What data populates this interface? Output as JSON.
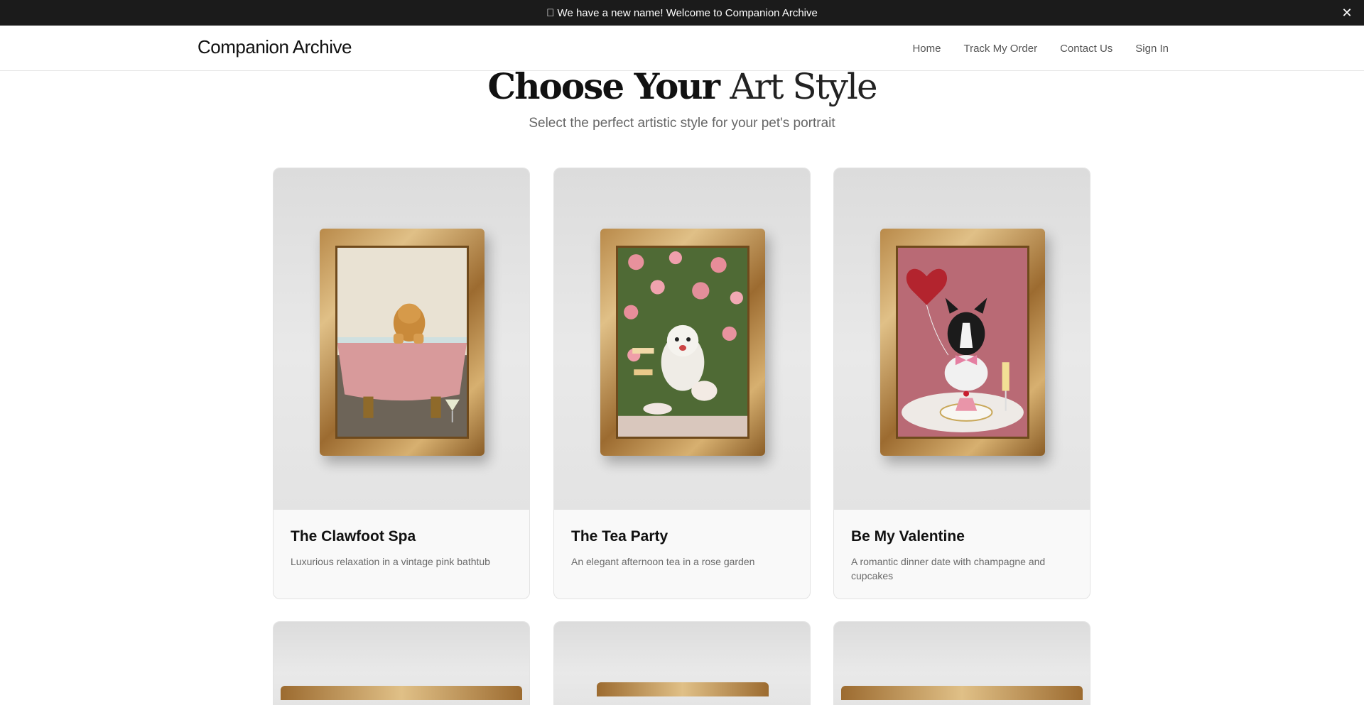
{
  "announcement": {
    "text": " We have a new name! Welcome to Companion Archive",
    "close_icon": "✕"
  },
  "navbar": {
    "brand": "Companion Archive",
    "links": [
      "Home",
      "Track My Order",
      "Contact Us",
      "Sign In"
    ]
  },
  "hero": {
    "title_part1": "Choose Your",
    "title_part2": "Art Style",
    "subtitle": "Select the perfect artistic style for your pet's portrait"
  },
  "styles": [
    {
      "title": "The Clawfoot Spa",
      "description": "Luxurious relaxation in a vintage pink bathtub"
    },
    {
      "title": "The Tea Party",
      "description": "An elegant afternoon tea in a rose garden"
    },
    {
      "title": "Be My Valentine",
      "description": "A romantic dinner date with champagne and cupcakes"
    }
  ],
  "colors": {
    "announcement_bg": "#1b1b1b",
    "card_bg": "#f9f9f9",
    "frame_gold": "#c79a55"
  }
}
